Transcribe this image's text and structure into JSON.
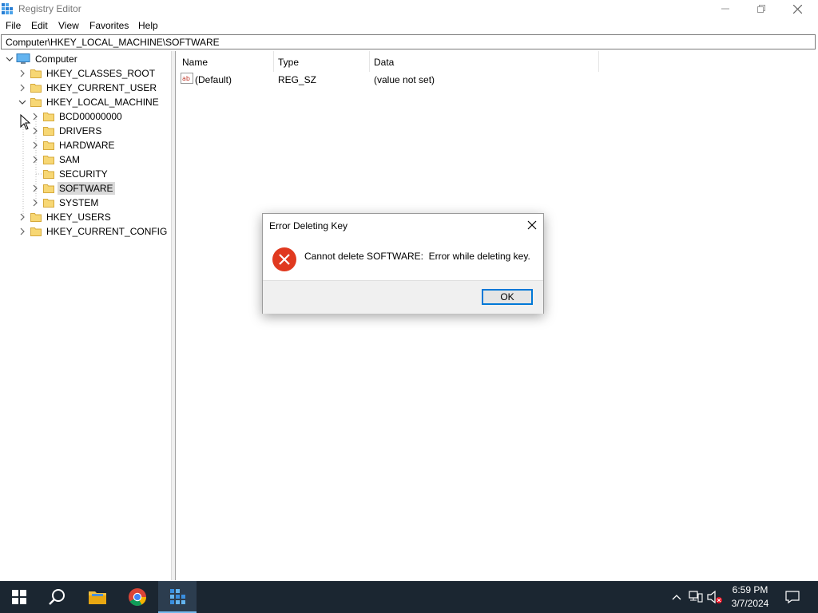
{
  "window": {
    "title": "Registry Editor",
    "minimize_icon": "minimize-icon",
    "maximize_icon": "restore-icon",
    "close_icon": "close-icon"
  },
  "menu": [
    "File",
    "Edit",
    "View",
    "Favorites",
    "Help"
  ],
  "address": "Computer\\HKEY_LOCAL_MACHINE\\SOFTWARE",
  "tree": {
    "root": "Computer",
    "hives": [
      "HKEY_CLASSES_ROOT",
      "HKEY_CURRENT_USER",
      "HKEY_LOCAL_MACHINE",
      "HKEY_USERS",
      "HKEY_CURRENT_CONFIG"
    ],
    "hklm_children": [
      "BCD00000000",
      "DRIVERS",
      "HARDWARE",
      "SAM",
      "SECURITY",
      "SOFTWARE",
      "SYSTEM"
    ],
    "selected": "SOFTWARE"
  },
  "list": {
    "columns": [
      "Name",
      "Type",
      "Data"
    ],
    "rows": [
      {
        "name": "(Default)",
        "type": "REG_SZ",
        "data": "(value not set)",
        "icon": "string-value-icon"
      }
    ]
  },
  "dialog": {
    "title": "Error Deleting Key",
    "message": "Cannot delete SOFTWARE:  Error while deleting key.",
    "ok_label": "OK",
    "icon": "error-icon"
  },
  "taskbar": {
    "items": [
      "start-icon",
      "search-icon",
      "file-explorer-icon",
      "chrome-icon",
      "registry-editor-icon"
    ],
    "active": "registry-editor-icon",
    "time": "6:59 PM",
    "date": "3/7/2024"
  },
  "colors": {
    "taskbar_bg": "#1b2631",
    "selection": "#d9d9d9",
    "accent": "#0078d7",
    "error_red": "#e81123"
  }
}
